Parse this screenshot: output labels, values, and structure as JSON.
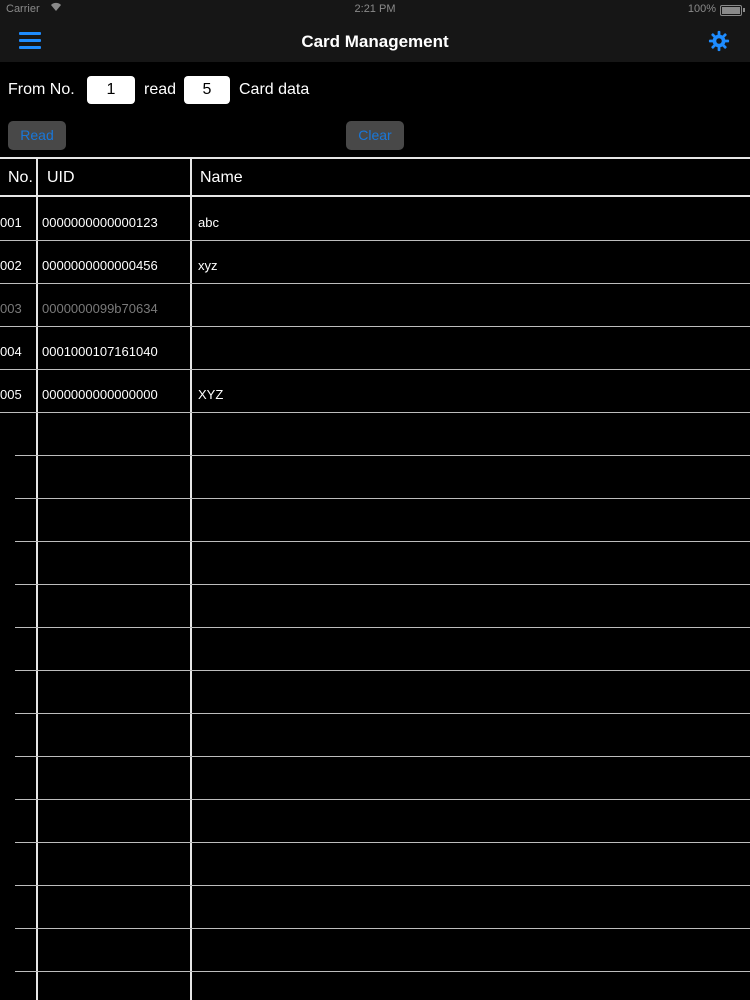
{
  "status_bar": {
    "carrier": "Carrier",
    "time": "2:21 PM",
    "battery": "100%"
  },
  "nav": {
    "title": "Card Management",
    "menu_icon": "hamburger-menu-icon",
    "settings_icon": "gear-icon",
    "accent_color": "#1e8cff"
  },
  "form": {
    "from_label": "From No.",
    "from_value": "1",
    "read_label": "read",
    "count_value": "5",
    "suffix_label": "Card data"
  },
  "buttons": {
    "read": "Read",
    "clear": "Clear"
  },
  "table": {
    "headers": {
      "no": "No.",
      "uid": "UID",
      "name": "Name"
    },
    "rows": [
      {
        "no": "001",
        "uid": "0000000000000123",
        "name": "abc",
        "dim": false
      },
      {
        "no": "002",
        "uid": "0000000000000456",
        "name": "xyz",
        "dim": false
      },
      {
        "no": "003",
        "uid": "0000000099b70634",
        "name": "",
        "dim": true
      },
      {
        "no": "004",
        "uid": "0001000107161040",
        "name": "",
        "dim": false
      },
      {
        "no": "005",
        "uid": "0000000000000000",
        "name": "XYZ",
        "dim": false
      }
    ]
  }
}
